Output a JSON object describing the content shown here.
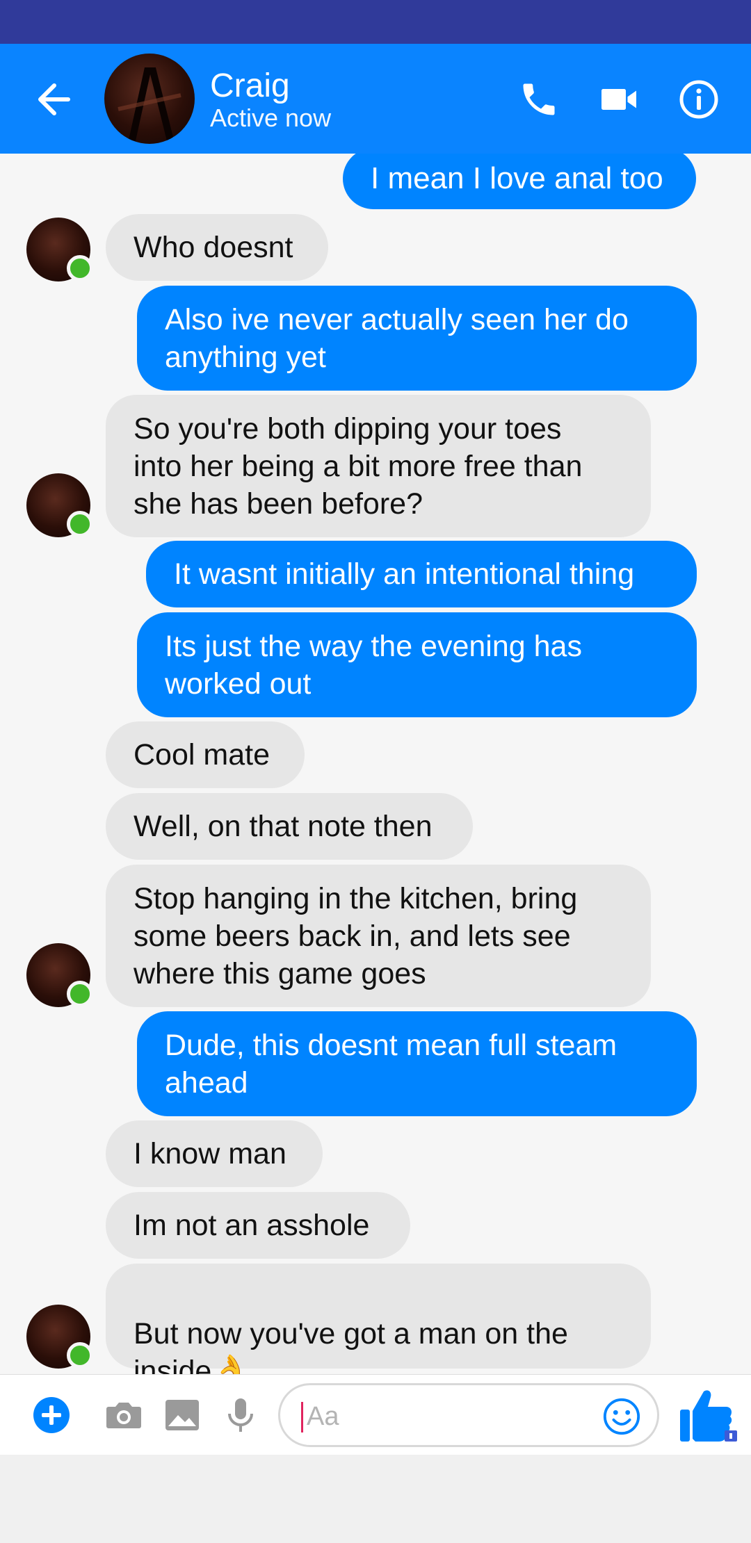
{
  "header": {
    "contact_name": "Craig",
    "contact_status": "Active now",
    "icons": [
      "back-arrow-icon",
      "phone-icon",
      "video-camera-icon",
      "info-icon"
    ]
  },
  "messages": [
    {
      "side": "out",
      "text": "I mean I love anal too"
    },
    {
      "side": "in",
      "text": "Who doesnt"
    },
    {
      "side": "out",
      "text": "Also ive never actually seen her do\nanything yet"
    },
    {
      "side": "in",
      "text": "So you're both dipping your toes\ninto her being a bit more free than\nshe has been before?"
    },
    {
      "side": "out",
      "text": "It wasnt initially an intentional thing"
    },
    {
      "side": "out",
      "text": "Its just the way the evening has\nworked out"
    },
    {
      "side": "in",
      "text": "Cool mate"
    },
    {
      "side": "in",
      "text": "Well, on that note then"
    },
    {
      "side": "in",
      "text": "Stop hanging in the kitchen, bring\nsome beers back in, and lets see\nwhere this game goes"
    },
    {
      "side": "out",
      "text": "Dude, this doesnt mean full steam\nahead"
    },
    {
      "side": "in",
      "text": "I know man"
    },
    {
      "side": "in",
      "text": "Im not an asshole"
    },
    {
      "side": "in",
      "text": "But now you've got a man on the\ninside",
      "emoji": "👌"
    }
  ],
  "composer": {
    "placeholder": "Aa",
    "icons": [
      "plus-icon",
      "camera-icon",
      "image-icon",
      "microphone-icon",
      "emoji-icon",
      "thumbs-up-icon"
    ]
  },
  "colors": {
    "status_bar": "#303a9a",
    "header": "#0a84ff",
    "outgoing_bubble": "#0084ff",
    "incoming_bubble": "#e6e6e6",
    "presence": "#42b72a"
  }
}
